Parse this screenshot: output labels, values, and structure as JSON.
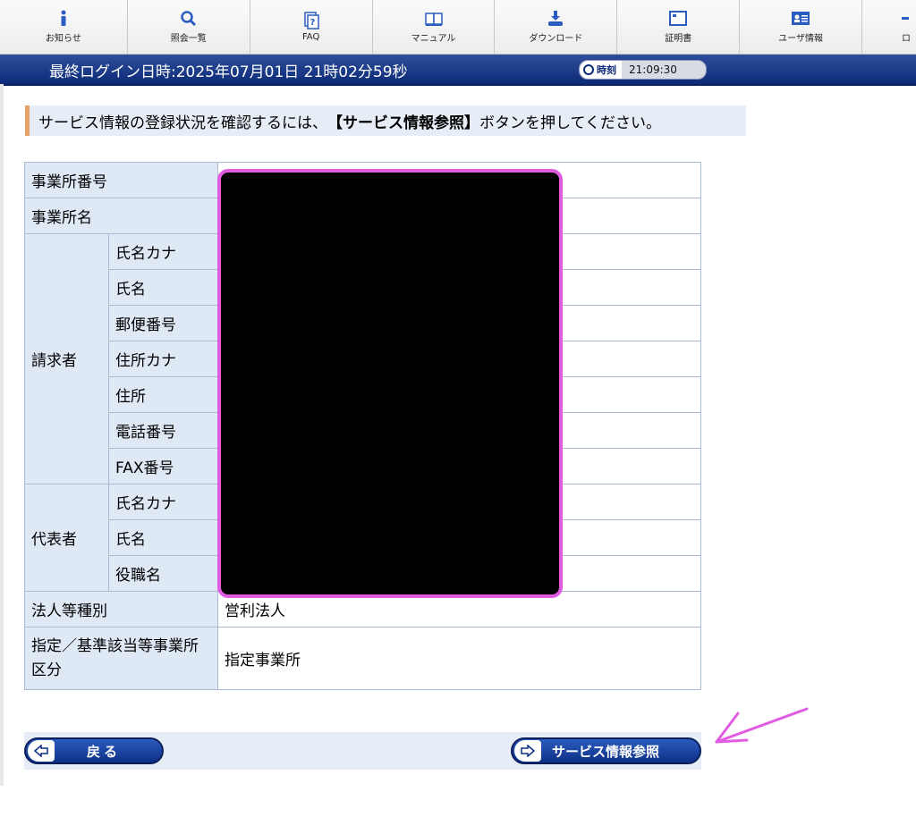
{
  "nav": {
    "items": [
      {
        "label": "お知らせ",
        "icon": "info-icon"
      },
      {
        "label": "照会一覧",
        "icon": "search-icon"
      },
      {
        "label": "FAQ",
        "icon": "faq-icon"
      },
      {
        "label": "マニュアル",
        "icon": "book-icon"
      },
      {
        "label": "ダウンロード",
        "icon": "download-icon"
      },
      {
        "label": "証明書",
        "icon": "certificate-icon"
      },
      {
        "label": "ユーザ情報",
        "icon": "user-card-icon"
      },
      {
        "label": "ロ",
        "icon": "logout-icon"
      }
    ]
  },
  "infobar": {
    "last_login": "最終ログイン日時:2025年07月01日 21時02分59秒",
    "clock_label": "時刻",
    "clock_time": "21:09:30"
  },
  "message": {
    "prefix": "サービス情報の登録状況を確認するには、",
    "bold": "【サービス情報参照】",
    "suffix": "ボタンを押してください。"
  },
  "table": {
    "office_number": "事業所番号",
    "office_name": "事業所名",
    "requester": "請求者",
    "requester_rows": [
      "氏名カナ",
      "氏名",
      "郵便番号",
      "住所カナ",
      "住所",
      "電話番号",
      "FAX番号"
    ],
    "representative": "代表者",
    "representative_rows": [
      "氏名カナ",
      "氏名",
      "役職名"
    ],
    "corp_type_label": "法人等種別",
    "corp_type_value": "営利法人",
    "designation_label": "指定／基準該当等事業所区分",
    "designation_value": "指定事業所"
  },
  "buttons": {
    "back": "戻る",
    "service_ref": "サービス情報参照"
  },
  "colors": {
    "header_blue": "#0c2a78",
    "label_bg": "#dfe8f5",
    "redaction_border": "#e05ce0",
    "annotation_arrow": "#e05ce0"
  }
}
